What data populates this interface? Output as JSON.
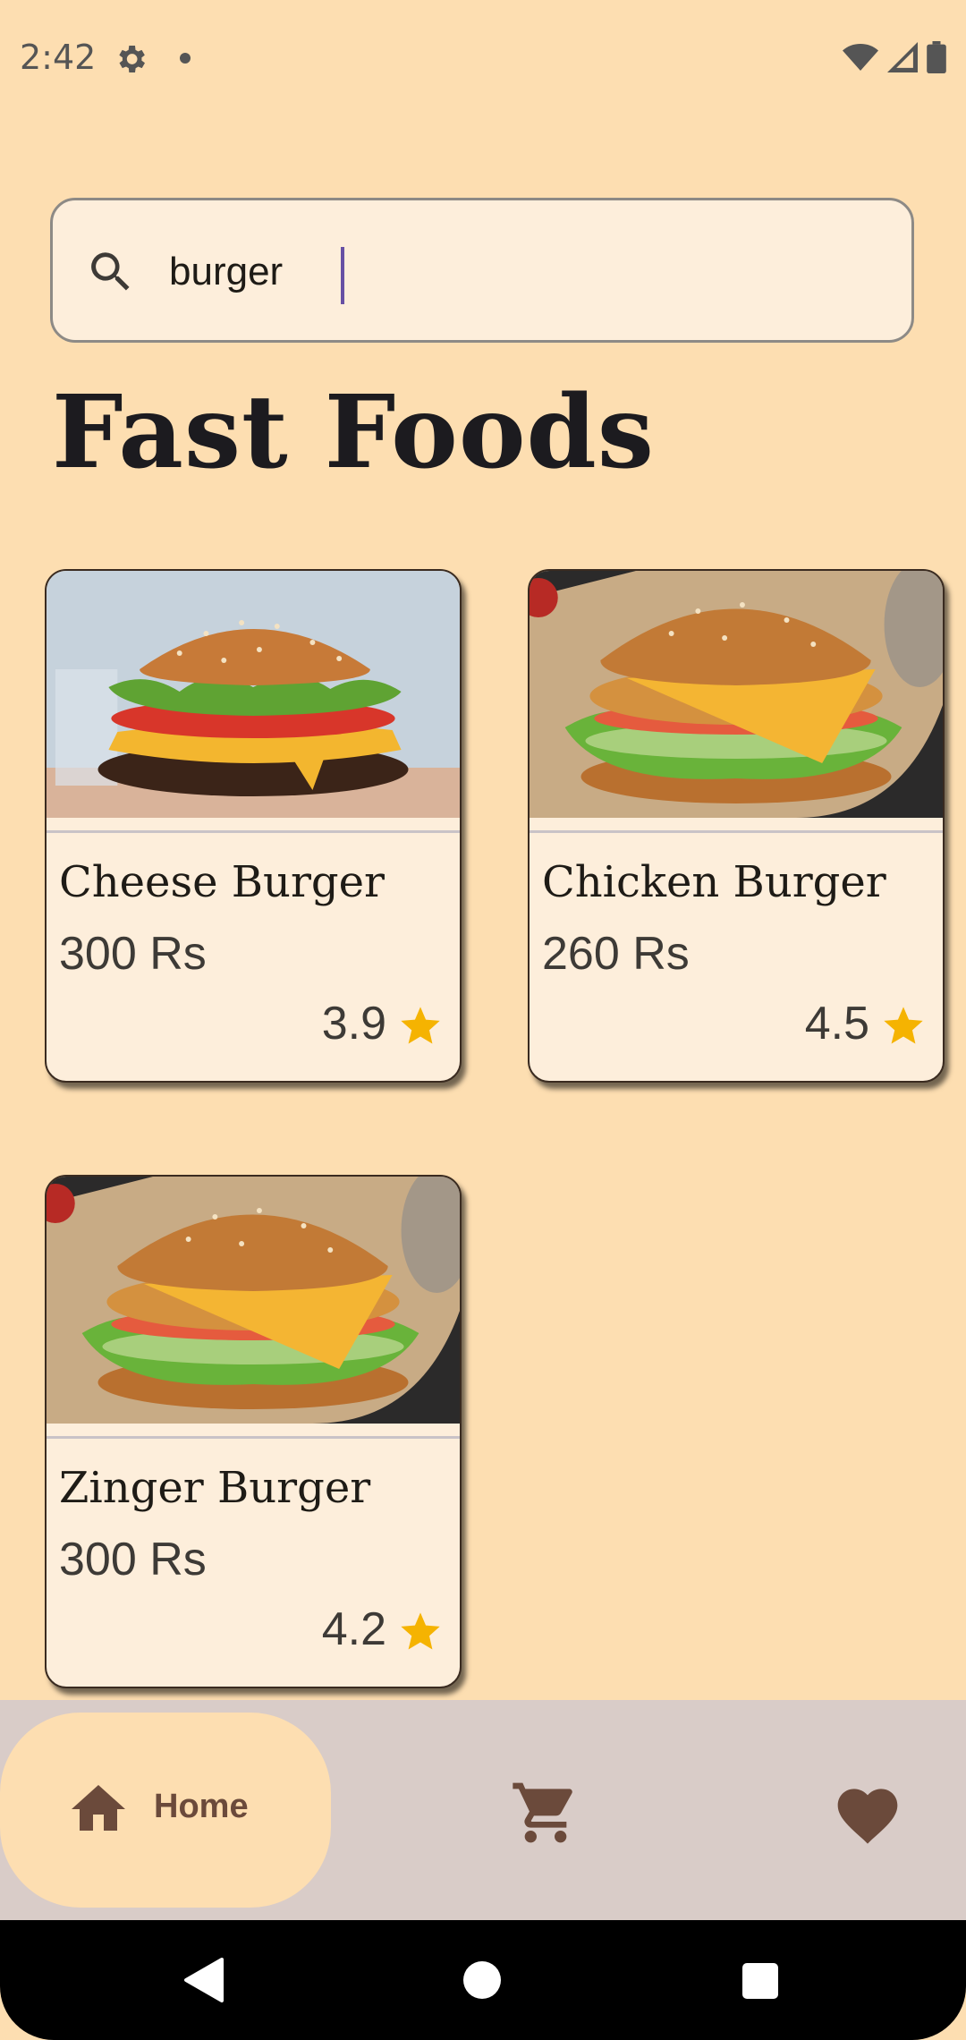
{
  "status_bar": {
    "time": "2:42"
  },
  "search": {
    "value": "burger",
    "placeholder": ""
  },
  "page": {
    "title": "Fast Foods"
  },
  "items": [
    {
      "name": "Cheese Burger",
      "price": "300 Rs",
      "rating": "3.9",
      "image": "cheese-burger-photo"
    },
    {
      "name": "Chicken Burger",
      "price": "260 Rs",
      "rating": "4.5",
      "image": "chicken-burger-photo"
    },
    {
      "name": "Zinger Burger",
      "price": "300 Rs",
      "rating": "4.2",
      "image": "zinger-burger-photo"
    }
  ],
  "bottom_nav": {
    "selected": "Home",
    "items": [
      {
        "label": "Home",
        "icon": "home-icon"
      },
      {
        "label": "",
        "icon": "cart-icon"
      },
      {
        "label": "",
        "icon": "heart-icon"
      }
    ]
  },
  "colors": {
    "background": "#FDDEB1",
    "card": "#FDEEDB",
    "accent": "#6750A4",
    "star": "#F5B301",
    "nav_bar": "#D9CCC8",
    "nav_icon": "#6b4a3b"
  }
}
